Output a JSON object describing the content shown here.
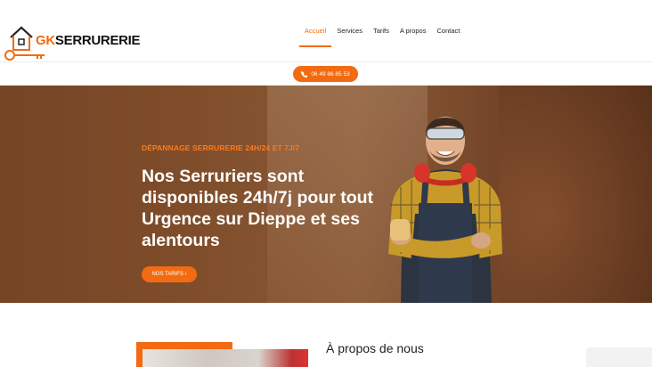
{
  "brand": {
    "prefix": "GK",
    "name": "SERRURERIE",
    "accent": "#f26b12"
  },
  "nav": {
    "items": [
      {
        "label": "Accueil",
        "active": true
      },
      {
        "label": "Services"
      },
      {
        "label": "Tarifs"
      },
      {
        "label": "A propos"
      },
      {
        "label": "Contact"
      }
    ]
  },
  "phone": {
    "label": "06 49 86 85 53"
  },
  "hero": {
    "subtitle": "DÉPANNAGE SERRURERIE 24H/24 ET 7J/7",
    "title": "Nos Serruriers sont disponibles 24h/7j pour tout Urgence sur Dieppe et ses alentours",
    "button": "NOS TARIFS ›"
  },
  "about": {
    "title": "À propos de nous"
  }
}
